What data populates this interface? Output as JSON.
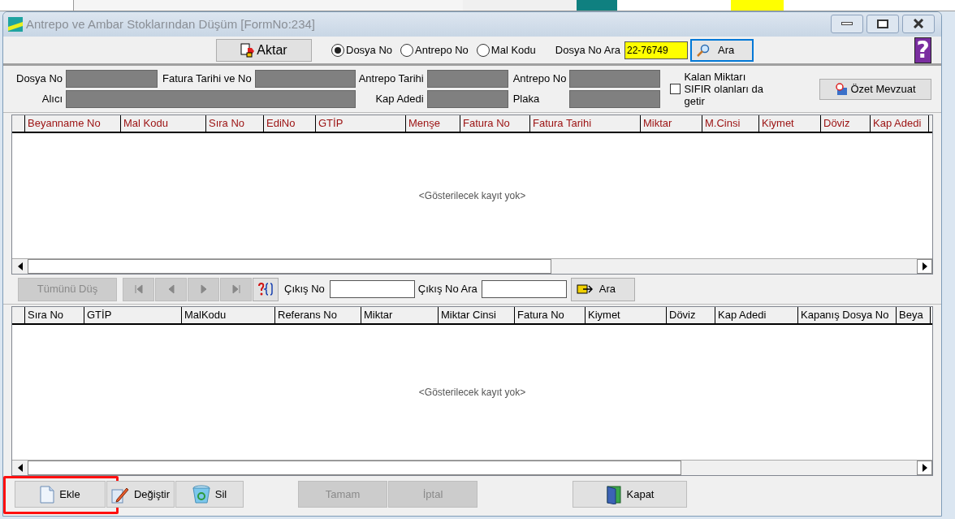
{
  "window": {
    "title": "Antrepo ve Ambar Stoklarından Düşüm [FormNo:234]"
  },
  "toolbar": {
    "transfer_button": {
      "label": "Aktar"
    },
    "search_by": [
      {
        "label": "Dosya No",
        "selected": true
      },
      {
        "label": "Antrepo No",
        "selected": false
      },
      {
        "label": "Mal Kodu",
        "selected": false
      }
    ],
    "search_label": {
      "label": "Dosya No Ara"
    },
    "search_value": "22-76749",
    "search_button": {
      "label": "Ara"
    },
    "help_button": {
      "label": "?"
    }
  },
  "info": {
    "fields": [
      {
        "label": "Dosya No"
      },
      {
        "label": "Fatura Tarihi ve No"
      },
      {
        "label": "Antrepo Tarihi"
      },
      {
        "label": "Antrepo No"
      },
      {
        "label": "Alıcı"
      },
      {
        "label": "Kap Adedi"
      },
      {
        "label": "Plaka"
      }
    ],
    "zero_checkbox": {
      "label": "Kalan Miktarı SIFIR olanları da getir",
      "checked": false
    },
    "summary_button": {
      "label": "Özet Mevzuat"
    }
  },
  "table_1": {
    "columns": [
      "Beyanname No",
      "Mal Kodu",
      "Sıra No",
      "EdiNo",
      "GTİP",
      "Menşe",
      "Fatura No",
      "Fatura Tarihi",
      "Miktar",
      "M.Cinsi",
      "Kiymet",
      "Döviz",
      "Kap Adedi"
    ],
    "empty_text": "<Gösterilecek kayıt yok>"
  },
  "toolbar_2": {
    "drop_all_button": {
      "label": "Tümünü Düş",
      "disabled": true
    },
    "exit_no_label": "Çıkış No",
    "exit_search_label": {
      "label": "Çıkış No Ara"
    },
    "search_button": {
      "label": "Ara"
    }
  },
  "table_2": {
    "columns": [
      "Sıra No",
      "GTİP",
      "MalKodu",
      "Referans No",
      "Miktar",
      "Miktar Cinsi",
      "Fatura No",
      "Kiymet",
      "Döviz",
      "Kap Adedi",
      "Kapanış Dosya No",
      "Beya"
    ],
    "empty_text": "<Gösterilecek kayıt yok>"
  },
  "buttons": [
    {
      "kind": "add",
      "label": "Ekle",
      "disabled": false,
      "highlighted": true
    },
    {
      "kind": "edit",
      "label": "Değiştir",
      "disabled": false,
      "highlighted": false
    },
    {
      "kind": "delete",
      "label": "Sil",
      "disabled": false,
      "highlighted": false
    },
    {
      "kind": "ok",
      "label": "Tamam",
      "disabled": true,
      "highlighted": false
    },
    {
      "kind": "cancel",
      "label": "İptal",
      "disabled": true,
      "highlighted": false
    },
    {
      "kind": "close",
      "label": "Kapat",
      "disabled": false,
      "highlighted": false
    }
  ]
}
